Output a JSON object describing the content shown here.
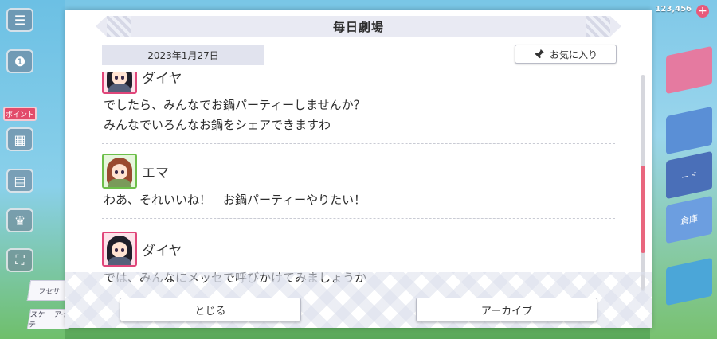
{
  "background": {
    "left_menu": {
      "event_label": "ポイント",
      "tag_top": "フセサ",
      "tag_bottom": "スケー アイテ"
    },
    "right_panel": {
      "resource_text": "123,456",
      "label_mid": "ード",
      "label_storage": "倉庫"
    }
  },
  "modal": {
    "title": "毎日劇場",
    "date": "2023年1月27日",
    "favorite_label": "お気に入り",
    "messages": [
      {
        "speaker": "ダイヤ",
        "avatar": "dia-avatar",
        "lines": [
          "でしたら、みんなでお鍋パーティーしませんか？",
          "みんなでいろんなお鍋をシェアできますわ"
        ]
      },
      {
        "speaker": "エマ",
        "avatar": "emma-avatar",
        "lines": [
          "わあ、それいいね！　お鍋パーティーやりたい！"
        ]
      },
      {
        "speaker": "ダイヤ",
        "avatar": "dia-avatar",
        "lines": [
          "では、みんなにメッセで呼びかけてみましょうか"
        ]
      }
    ],
    "close_label": "とじる",
    "archive_label": "アーカイブ"
  },
  "colors": {
    "accent_pink": "#e9667e",
    "title_bar": "#e9eaf3",
    "date_bg": "#e1e3ee"
  }
}
